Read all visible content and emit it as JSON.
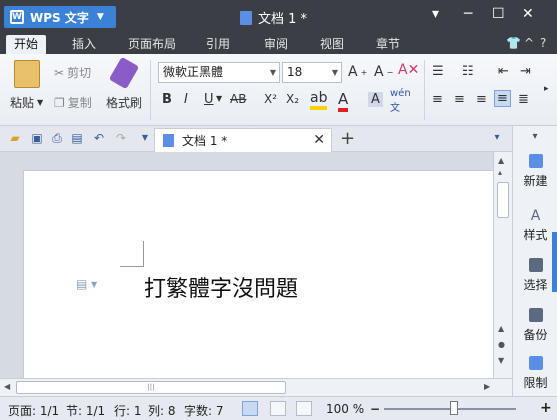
{
  "titlebar": {
    "app_name": "WPS 文字",
    "doc_title": "文档 1 *"
  },
  "ribbon_tabs": [
    "开始",
    "插入",
    "页面布局",
    "引用",
    "审阅",
    "视图",
    "章节"
  ],
  "active_tab": "开始",
  "clipboard": {
    "paste": "粘贴",
    "cut": "剪切",
    "copy": "复制",
    "format_painter": "格式刷"
  },
  "font": {
    "family": "微軟正黑體",
    "size": "18"
  },
  "format_buttons": [
    "B",
    "I",
    "U",
    "AB",
    "X²",
    "X₂"
  ],
  "document_tab": {
    "title": "文档 1 *"
  },
  "document": {
    "text": "打繁體字沒問題"
  },
  "task_pane": {
    "items": [
      "新建",
      "样式",
      "选择",
      "备份",
      "限制"
    ]
  },
  "status_bar": {
    "page": "页面: 1/1",
    "section": "节: 1/1",
    "line": "行: 1",
    "column": "列: 8",
    "word_count": "字数: 7",
    "zoom": "100 %"
  },
  "colors": {
    "titlebar": "#3b3f45",
    "accent": "#3b82d6",
    "highlight_yellow": "#f5d400",
    "font_color_red": "#e02020"
  }
}
